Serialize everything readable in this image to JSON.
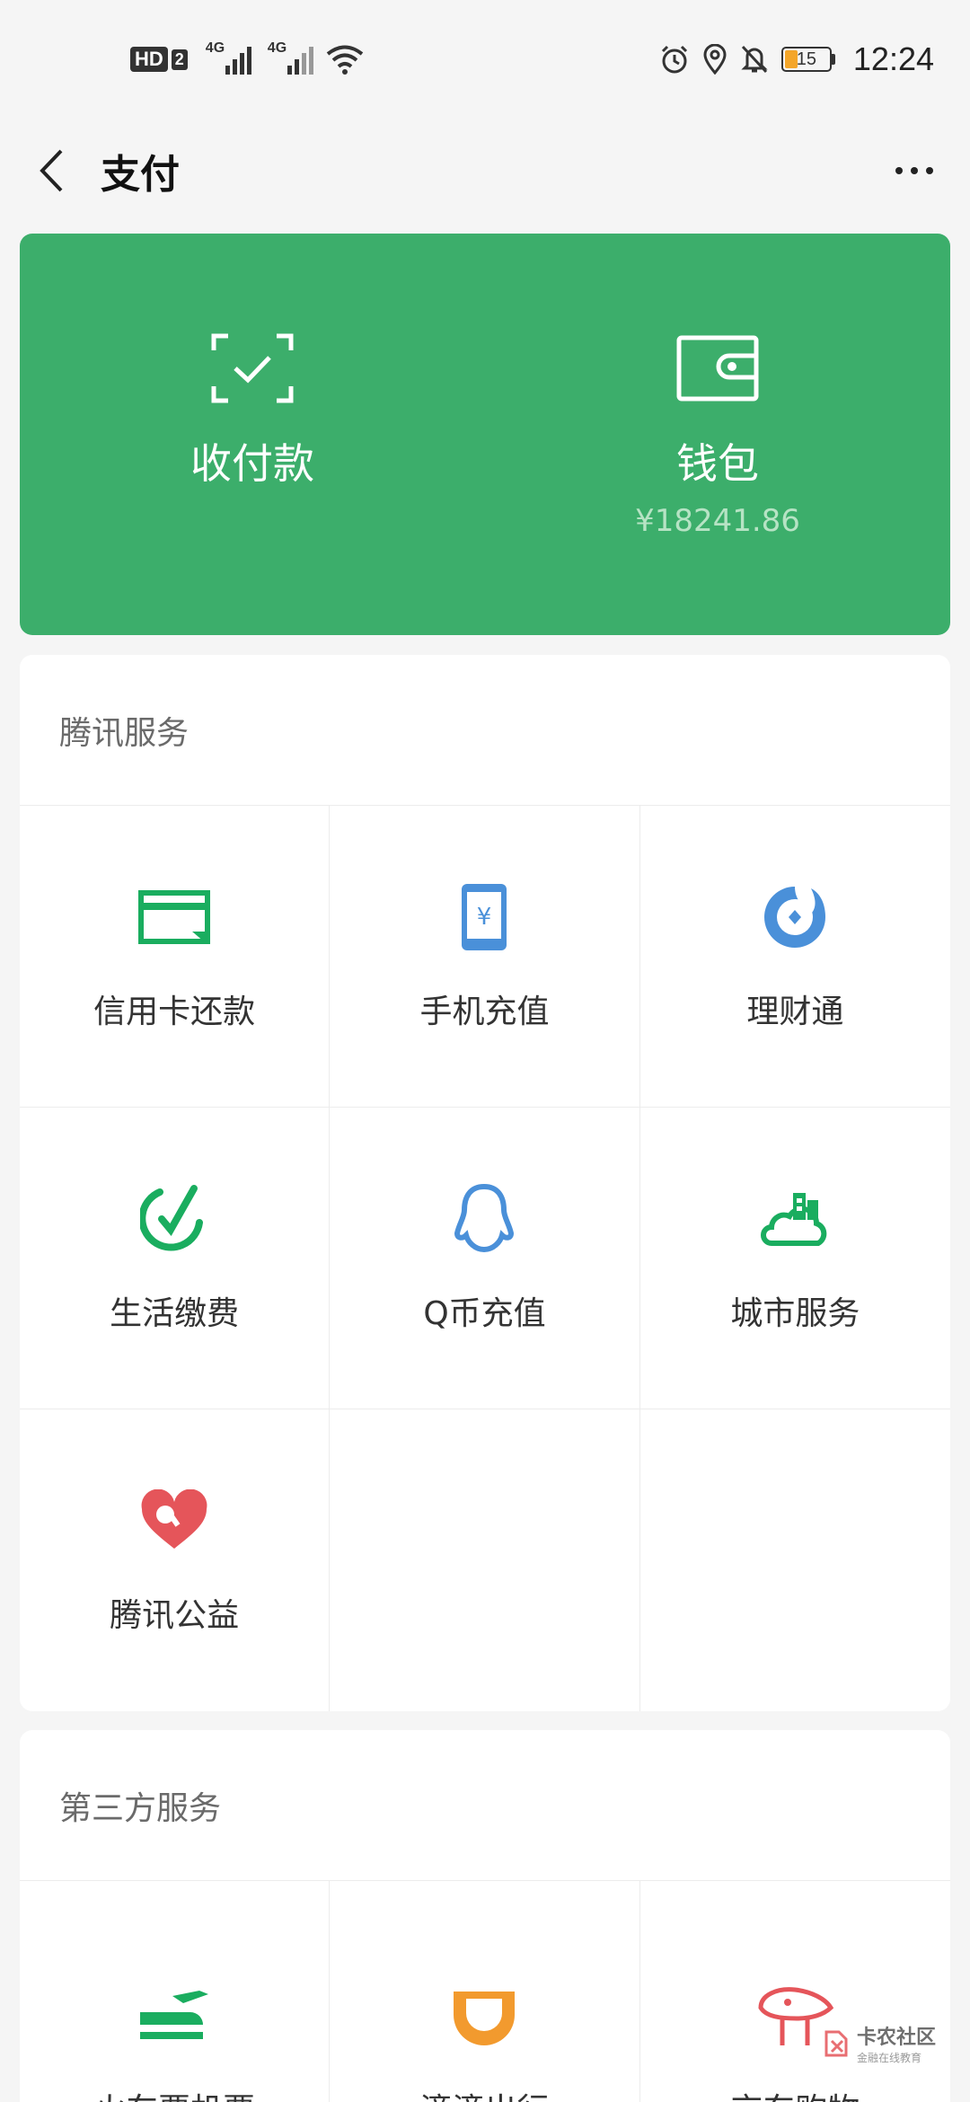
{
  "status_bar": {
    "hd": "HD",
    "sim": "2",
    "net1": "4G",
    "net2": "4G",
    "battery": "15",
    "time": "12:24"
  },
  "nav": {
    "title": "支付"
  },
  "pay_card": {
    "collect_label": "收付款",
    "wallet_label": "钱包",
    "wallet_amount": "¥18241.86"
  },
  "tencent_services": {
    "header": "腾讯服务",
    "items": [
      {
        "label": "信用卡还款"
      },
      {
        "label": "手机充值"
      },
      {
        "label": "理财通"
      },
      {
        "label": "生活缴费"
      },
      {
        "label": "Q币充值"
      },
      {
        "label": "城市服务"
      },
      {
        "label": "腾讯公益"
      }
    ]
  },
  "third_party_services": {
    "header": "第三方服务",
    "items": [
      {
        "label": "火车票机票"
      },
      {
        "label": "滴滴出行"
      },
      {
        "label": "京东购物"
      }
    ]
  },
  "watermark": {
    "title": "卡农社区",
    "subtitle": "金融在线教育"
  },
  "colors": {
    "green": "#3cae6b",
    "service_green": "#1aad5f",
    "service_blue": "#4a90d9",
    "service_red": "#e5555a",
    "didi_orange": "#f29a2e"
  }
}
